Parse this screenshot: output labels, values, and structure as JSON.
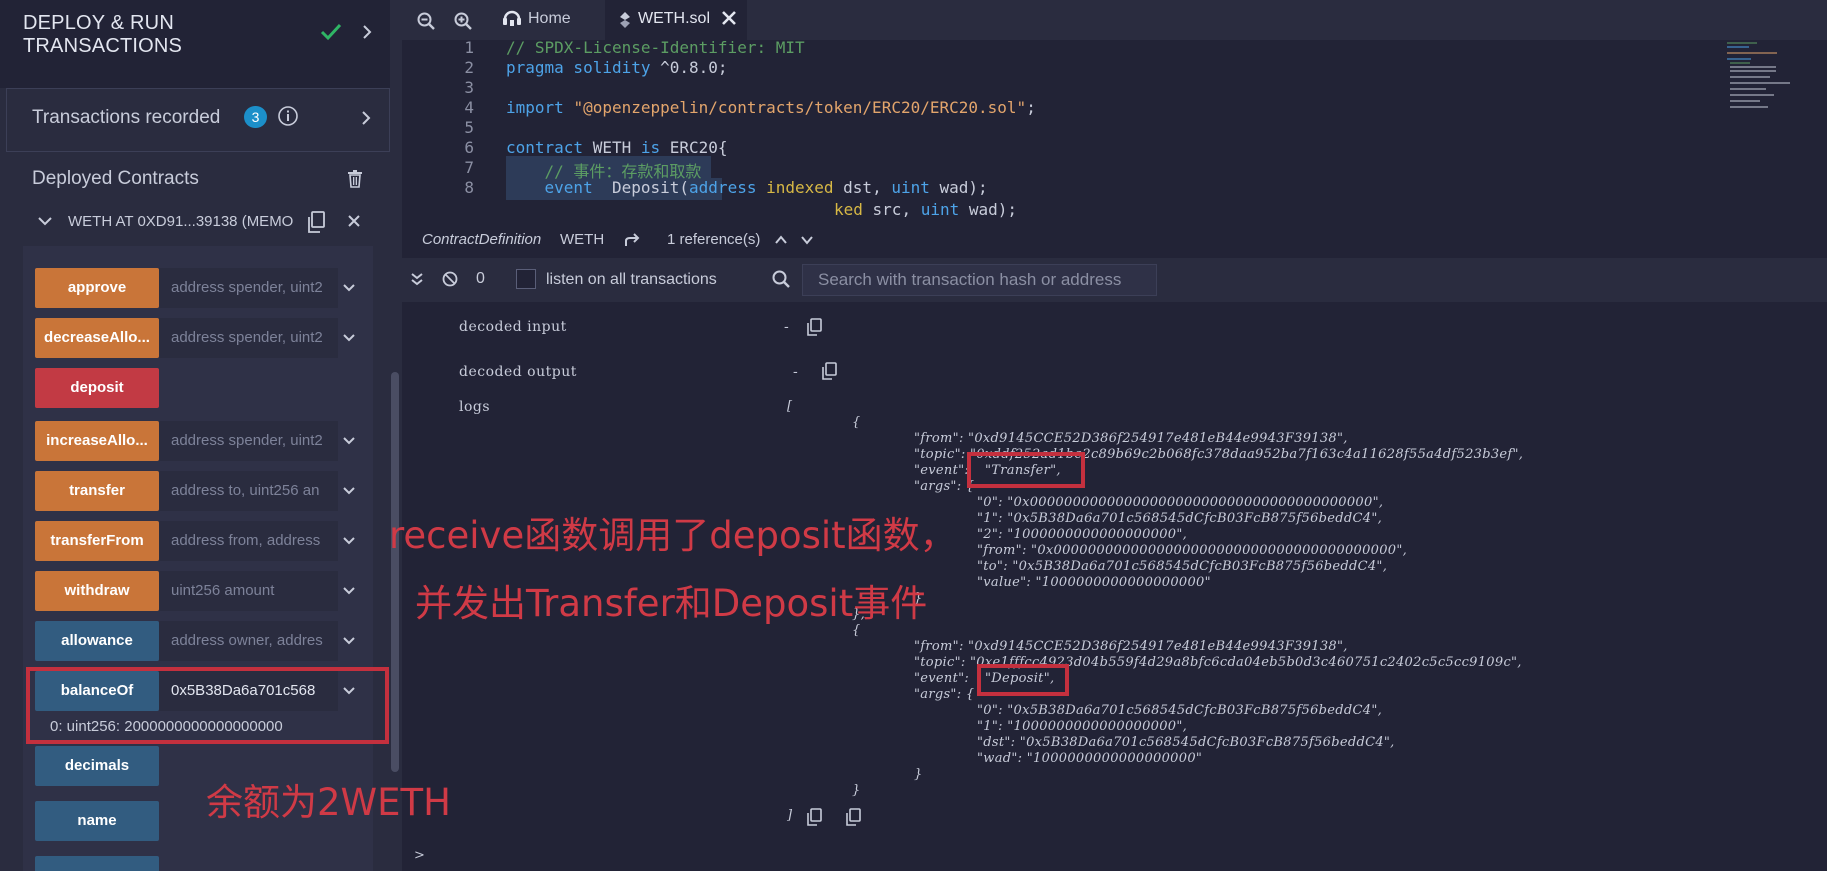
{
  "panel": {
    "title_line1": "DEPLOY & RUN",
    "title_line2": "TRANSACTIONS",
    "tx_recorded_label": "Transactions recorded",
    "tx_recorded_count": "3",
    "deployed_label": "Deployed Contracts",
    "instance_title": "WETH AT 0XD91...39138 (MEMO",
    "functions": [
      {
        "label": "approve",
        "input": "address spender, uint2",
        "color": "orange"
      },
      {
        "label": "decreaseAllo...",
        "input": "address spender, uint2",
        "color": "orange"
      },
      {
        "label": "deposit",
        "input": "",
        "color": "red"
      },
      {
        "label": "increaseAllo...",
        "input": "address spender, uint2",
        "color": "orange"
      },
      {
        "label": "transfer",
        "input": "address to, uint256 an",
        "color": "orange"
      },
      {
        "label": "transferFrom",
        "input": "address from, address",
        "color": "orange"
      },
      {
        "label": "withdraw",
        "input": "uint256 amount",
        "color": "orange"
      },
      {
        "label": "allowance",
        "input": "address owner, addres",
        "color": "blue"
      },
      {
        "label": "balanceOf",
        "input": "0x5B38Da6a701c568",
        "color": "blue"
      },
      {
        "label": "decimals",
        "input": "",
        "color": "blue"
      },
      {
        "label": "name",
        "input": "",
        "color": "blue"
      }
    ],
    "balance_result": "0: uint256: 2000000000000000000"
  },
  "tabs": {
    "home": "Home",
    "file": "WETH.sol"
  },
  "editor": {
    "lines": [
      {
        "n": "1"
      },
      {
        "n": "2"
      },
      {
        "n": "3"
      },
      {
        "n": "4"
      },
      {
        "n": "5"
      },
      {
        "n": "6"
      },
      {
        "n": "7"
      },
      {
        "n": "8"
      }
    ],
    "l1": "// SPDX-License-Identifier: MIT",
    "l2_kw": "pragma solidity",
    "l2_rest": " ^0.8.0;",
    "l4_kw": "import",
    "l4_str": "\"@openzeppelin/contracts/token/ERC20/ERC20.sol\"",
    "l4_end": ";",
    "l6_kw": "contract",
    "l6_name": " WETH ",
    "l6_is": "is",
    "l6_rest": " ERC20{",
    "l7": "    // 事件：存款和取款",
    "l8_a": "    event",
    "l8_b": "  Deposit(",
    "l8_c": "address",
    "l8_d": " indexed",
    "l8_e": " dst, ",
    "l8_f": "uint",
    "l8_g": " wad);",
    "l9_a": "ked",
    "l9_b": " src, ",
    "l9_c": "uint",
    "l9_d": " wad);",
    "hover_type": "ContractDefinition",
    "hover_name": "WETH",
    "hover_refs": "1 reference(s)"
  },
  "terminal": {
    "count": "0",
    "listen_label": "listen on all transactions",
    "search_placeholder": "Search with transaction hash or address",
    "decoded_input_label": "decoded input",
    "decoded_input_value": "-",
    "decoded_output_label": "decoded output",
    "decoded_output_value": "-",
    "logs_label": "logs",
    "logs_open": "[",
    "logs_close": "]",
    "log1": {
      "open": "{",
      "from": "\"from\": \"0xd9145CCE52D386f254917e481eB44e9943F39138\",",
      "topic": "\"topic\": \"0xddf252ad1be2c89b69c2b068fc378daa952ba7f163c4a11628f55a4df523b3ef\",",
      "event_key": "\"event\":",
      "event_val": "\"Transfer\",",
      "args": "\"args\": {",
      "a0": "\"0\": \"0x0000000000000000000000000000000000000000\",",
      "a1": "\"1\": \"0x5B38Da6a701c568545dCfcB03FcB875f56beddC4\",",
      "a2": "\"2\": \"1000000000000000000\",",
      "afrom": "\"from\": \"0x0000000000000000000000000000000000000000\",",
      "ato": "\"to\": \"0x5B38Da6a701c568545dCfcB03FcB875f56beddC4\",",
      "avalue": "\"value\": \"1000000000000000000\"",
      "args_close": "}",
      "close": "},"
    },
    "log2": {
      "open": "{",
      "from": "\"from\": \"0xd9145CCE52D386f254917e481eB44e9943F39138\",",
      "topic": "\"topic\": \"0xe1fffcc4923d04b559f4d29a8bfc6cda04eb5b0d3c460751c2402c5c5cc9109c\",",
      "event_key": "\"event\":",
      "event_val": "\"Deposit\",",
      "args": "\"args\": {",
      "a0": "\"0\": \"0x5B38Da6a701c568545dCfcB03FcB875f56beddC4\",",
      "a1": "\"1\": \"1000000000000000000\",",
      "adst": "\"dst\": \"0x5B38Da6a701c568545dCfcB03FcB875f56beddC4\",",
      "awad": "\"wad\": \"1000000000000000000\"",
      "args_close": "}",
      "close": "}"
    }
  },
  "annotations": {
    "line1": "receive函数调用了deposit函数，",
    "line2": "并发出Transfer和Deposit事件",
    "balance": "余额为2WETH"
  },
  "colors": {
    "orange": "#c97539",
    "red": "#c23a44",
    "blue": "#325c80",
    "annotation": "#d03a46",
    "badge": "#1c8fc9"
  }
}
